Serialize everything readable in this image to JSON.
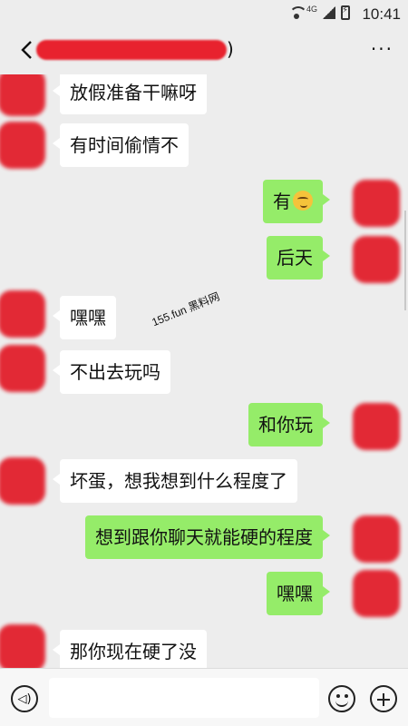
{
  "status_bar": {
    "network": "4G",
    "time": "10:41"
  },
  "header": {
    "title_suffix": ")",
    "more_label": "···"
  },
  "watermark": "155.fun 黑料网",
  "messages": [
    {
      "side": "in",
      "text": "放假准备干嘛呀"
    },
    {
      "side": "in",
      "text": "有时间偷情不"
    },
    {
      "side": "out",
      "text": "有",
      "emoji": "thinking-face"
    },
    {
      "side": "out",
      "text": "后天"
    },
    {
      "side": "in",
      "text": "嘿嘿"
    },
    {
      "side": "in",
      "text": "不出去玩吗"
    },
    {
      "side": "out",
      "text": "和你玩"
    },
    {
      "side": "in",
      "text": "坏蛋，想我想到什么程度了"
    },
    {
      "side": "out",
      "text": "想到跟你聊天就能硬的程度"
    },
    {
      "side": "out",
      "text": "嘿嘿"
    },
    {
      "side": "in",
      "text": "那你现在硬了没"
    }
  ],
  "input": {
    "placeholder": "",
    "value": ""
  },
  "colors": {
    "background": "#ededed",
    "outgoing_bubble": "#95ec69",
    "incoming_bubble": "#ffffff",
    "redaction": "#e21f2c"
  }
}
